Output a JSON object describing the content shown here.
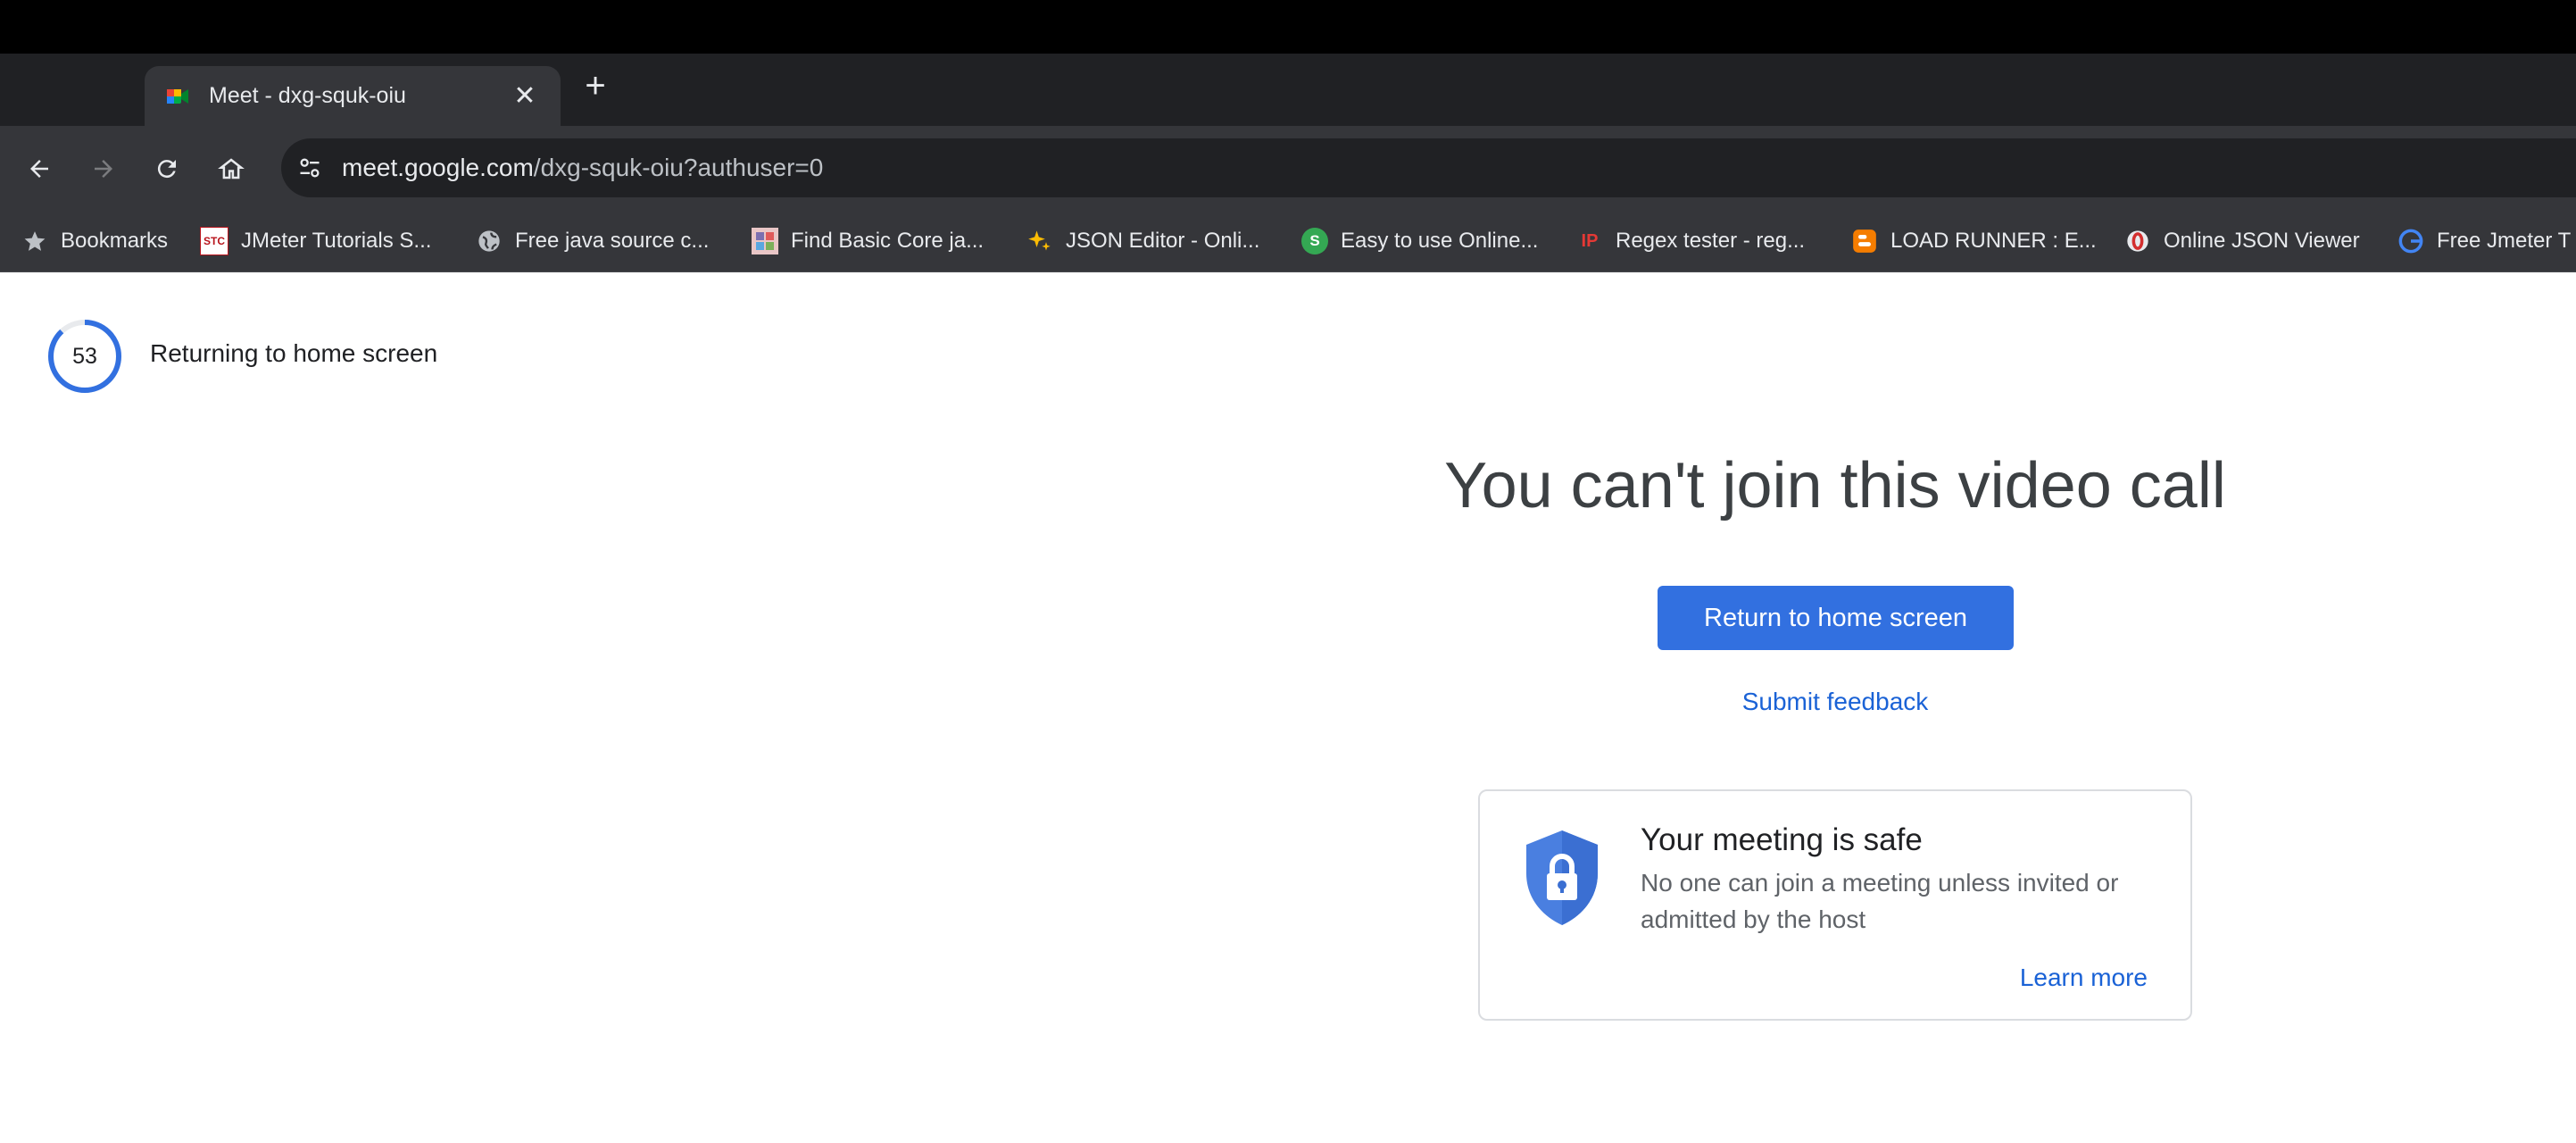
{
  "browser": {
    "tab": {
      "title": "Meet - dxg-squk-oiu",
      "close_glyph": "✕"
    },
    "new_tab_glyph": "+",
    "url": {
      "host": "meet.google.com",
      "path": "/dxg-squk-oiu?authuser=0"
    },
    "bookmarks": [
      {
        "label": "Bookmarks",
        "icon": "star-icon"
      },
      {
        "label": "JMeter Tutorials S...",
        "icon": "stc-icon",
        "icon_text": "STC"
      },
      {
        "label": "Free java source c...",
        "icon": "globe-icon"
      },
      {
        "label": "Find Basic Core ja...",
        "icon": "site-icon"
      },
      {
        "label": "JSON Editor - Onli...",
        "icon": "sparkle-icon"
      },
      {
        "label": "Easy to use Online...",
        "icon": "s-icon",
        "icon_text": "S"
      },
      {
        "label": "Regex tester - reg...",
        "icon": "ip-icon",
        "icon_text": "IP"
      },
      {
        "label": "LOAD RUNNER : E...",
        "icon": "blogger-icon"
      },
      {
        "label": "Online JSON Viewer",
        "icon": "opera-icon"
      },
      {
        "label": "Free Jmeter T",
        "icon": "google-icon"
      }
    ]
  },
  "countdown": {
    "value": "53",
    "progress": 0.88,
    "label": "Returning to home screen"
  },
  "main": {
    "headline": "You can't join this video call",
    "return_button": "Return to home screen",
    "feedback_link": "Submit feedback"
  },
  "safe_card": {
    "title": "Your meeting is safe",
    "description": "No one can join a meeting unless invited or admitted by the host",
    "link": "Learn more"
  },
  "colors": {
    "accent": "#3270e0",
    "link": "#1a62d6",
    "shield": "#4a7fe0"
  }
}
